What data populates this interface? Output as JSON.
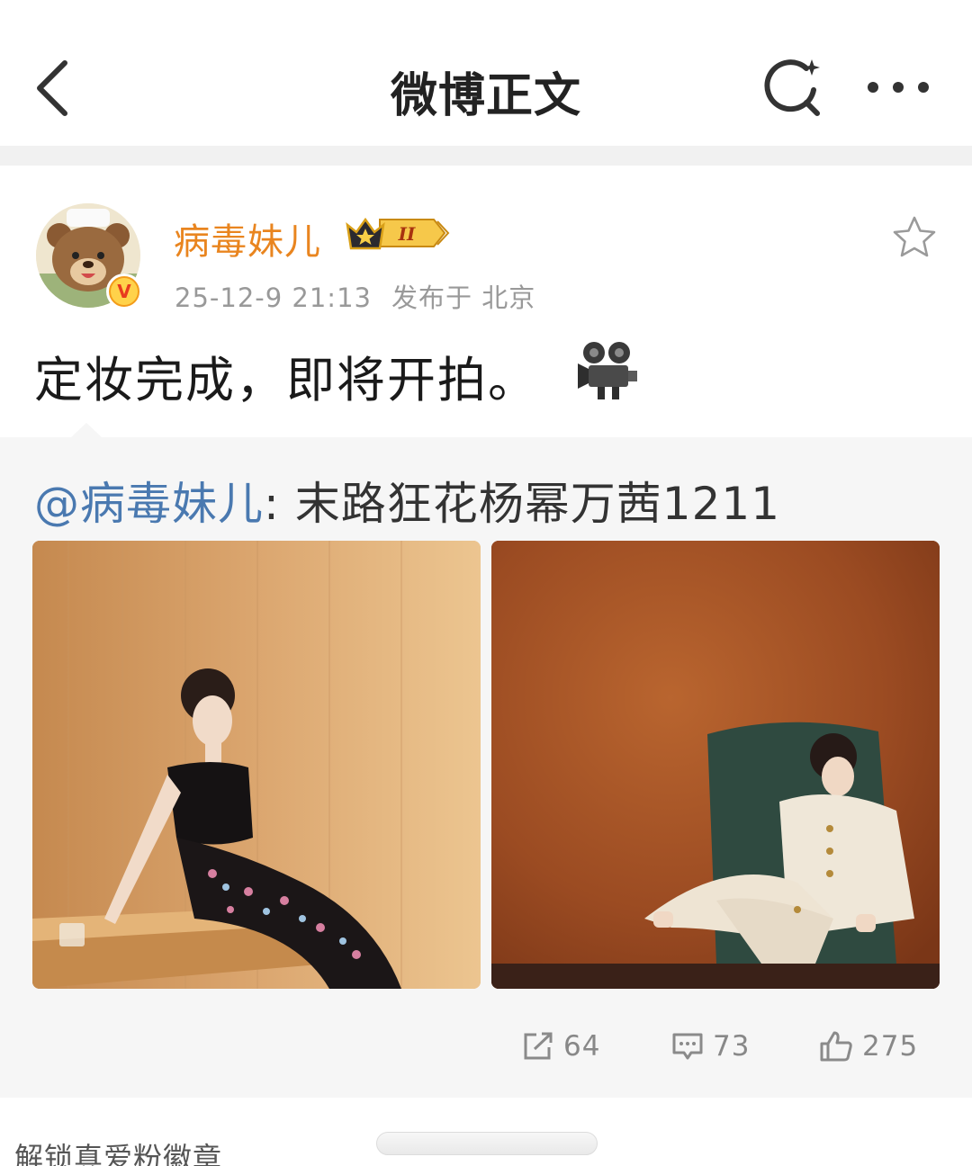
{
  "nav": {
    "title": "微博正文",
    "back_icon": "chevron-left-icon",
    "search_icon": "search-sparkle-icon",
    "more_icon": "more-dots-icon"
  },
  "post": {
    "username": "病毒妹儿",
    "vip_level": "II",
    "verified_badge": "V",
    "timestamp": "25-12-9 21:13",
    "location": "发布于 北京",
    "text": "定妆完成，即将开拍。",
    "emoji": "movie-camera-icon"
  },
  "repost": {
    "mention": "@病毒妹儿",
    "separator": ":",
    "text": "末路狂花杨幂万茜1211",
    "images": [
      {
        "alt": "woman in black floral strapless dress seated on wooden bench"
      },
      {
        "alt": "woman in cream suit seated on green chair"
      }
    ],
    "actions": {
      "repost_count": "64",
      "comment_count": "73",
      "like_count": "275"
    }
  },
  "footer": {
    "unlock_text": "解锁真爱粉徽章"
  },
  "colors": {
    "username": "#e9851f",
    "mention": "#4a79b0",
    "repost_bg": "#f6f6f6"
  }
}
